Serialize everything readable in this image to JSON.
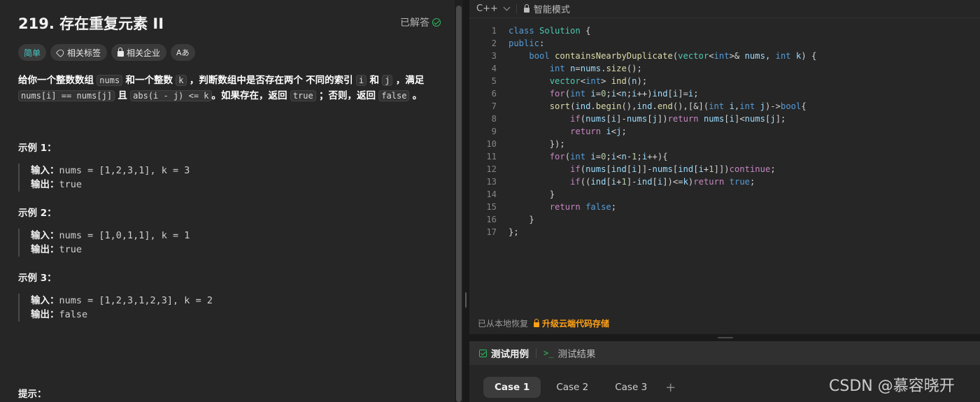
{
  "problem": {
    "title": "219. 存在重复元素 II",
    "status": "已解答",
    "tags": {
      "difficulty": "简单",
      "related_tags": "相关标签",
      "related_companies": "相关企业",
      "font_toggle": "Aあ"
    },
    "description": {
      "p1": "给你一个整数数组",
      "c_nums": "nums",
      "p2": "和一个整数",
      "c_k": "k",
      "p3": "，判断数组中是否存在两个",
      "bold": "不同的索引",
      "c_i": "i",
      "p4": "和",
      "c_j": "j",
      "p5": "，满足",
      "c_eq": "nums[i] == nums[j]",
      "p6": "且",
      "c_abs": "abs(i - j) <= k",
      "p7": "。如果存在，返回",
      "c_true": "true",
      "p8": "；否则，返回",
      "c_false": "false",
      "p9": "。"
    },
    "examples": [
      {
        "title": "示例 1：",
        "input_label": "输入：",
        "input": "nums = [1,2,3,1], k = 3",
        "output_label": "输出：",
        "output": "true"
      },
      {
        "title": "示例 2：",
        "input_label": "输入：",
        "input": "nums = [1,0,1,1], k = 1",
        "output_label": "输出：",
        "output": "true"
      },
      {
        "title": "示例 3：",
        "input_label": "输入：",
        "input": "nums = [1,2,3,1,2,3], k = 2",
        "output_label": "输出：",
        "output": "false"
      }
    ],
    "hint_title": "提示："
  },
  "editor": {
    "language": "C++",
    "mode": "智能模式",
    "restored_text": "已从本地恢复",
    "upgrade_text": "升级云端代码存储",
    "line_numbers": [
      "1",
      "2",
      "3",
      "4",
      "5",
      "6",
      "7",
      "8",
      "9",
      "10",
      "11",
      "12",
      "13",
      "14",
      "15",
      "16",
      "17"
    ]
  },
  "test_panel": {
    "tab_cases": "测试用例",
    "tab_results": "测试结果",
    "cases": [
      "Case 1",
      "Case 2",
      "Case 3"
    ],
    "add": "+"
  },
  "watermark": "CSDN @慕容晓开",
  "colors": {
    "easy": "#46c6c2",
    "accent_orange": "#ffa116",
    "success_green": "#2cbb5d"
  }
}
